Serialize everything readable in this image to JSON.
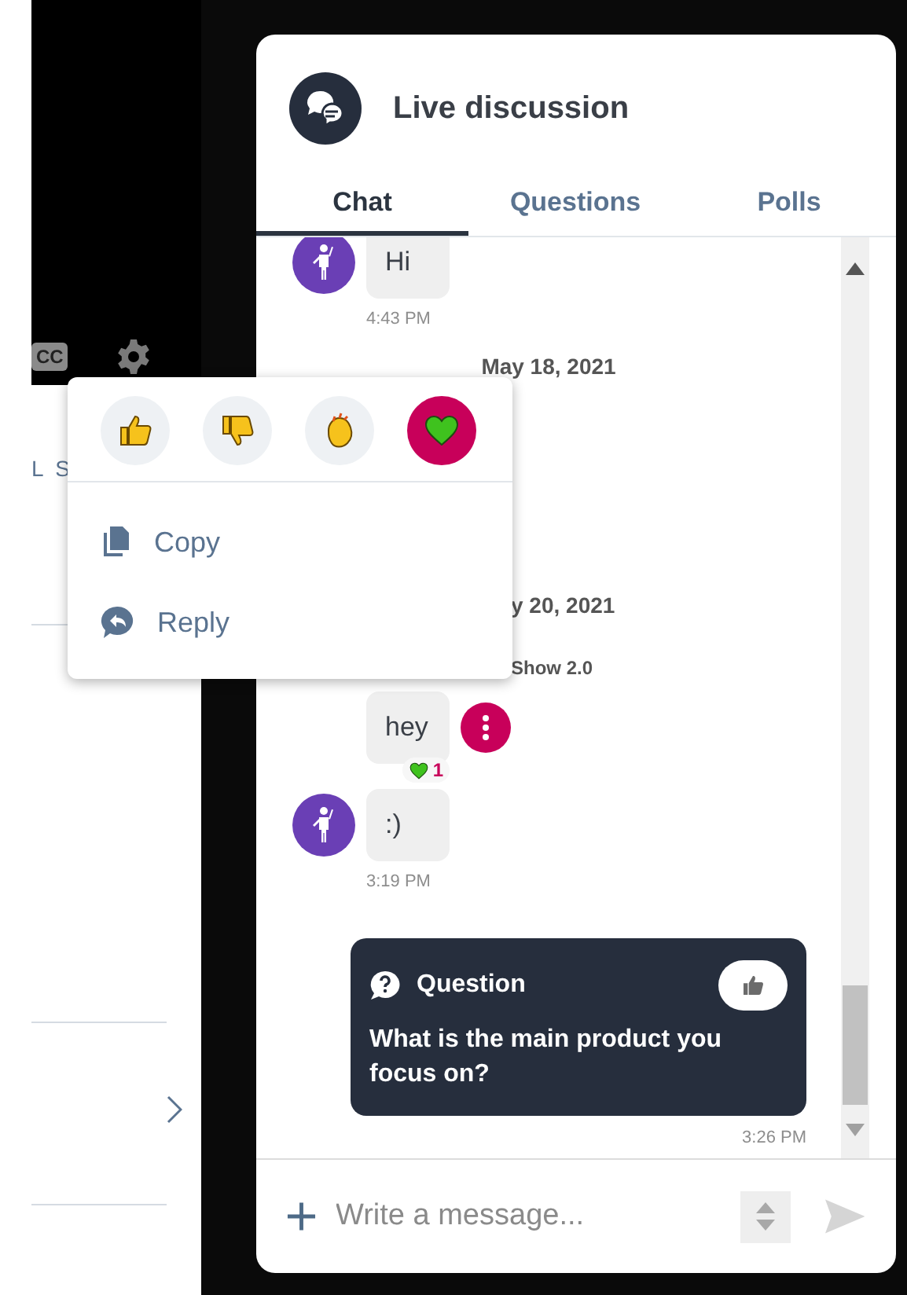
{
  "side_panel": {
    "cc_label": "CC",
    "link_text": "L S"
  },
  "chat_panel": {
    "title": "Live discussion",
    "tabs": [
      {
        "label": "Chat",
        "selected": true
      },
      {
        "label": "Questions",
        "selected": false
      },
      {
        "label": "Polls",
        "selected": false
      }
    ],
    "messages": [
      {
        "kind": "bubble",
        "avatar": true,
        "menu": false,
        "text": "Hi",
        "time": "4:43 PM"
      },
      {
        "kind": "date",
        "text": "May 18, 2021"
      },
      {
        "kind": "date_partial",
        "text": "y 20, 2021"
      },
      {
        "kind": "sender",
        "text": "Show 2.0"
      },
      {
        "kind": "bubble",
        "avatar": false,
        "text": "hey",
        "menu": true,
        "reaction": {
          "kind": "heart",
          "count": "1"
        }
      },
      {
        "kind": "bubble",
        "avatar": true,
        "menu": false,
        "text": ":)",
        "time": "3:19 PM"
      },
      {
        "kind": "question",
        "label": "Question",
        "text": "What is the main product you focus on?",
        "time": "3:26 PM"
      }
    ],
    "input": {
      "placeholder": "Write a message..."
    }
  },
  "context_menu": {
    "reactions": [
      {
        "kind": "thumbs_up",
        "selected": false
      },
      {
        "kind": "thumbs_down",
        "selected": false
      },
      {
        "kind": "clap",
        "selected": false
      },
      {
        "kind": "heart",
        "selected": true
      }
    ],
    "items": [
      {
        "kind": "copy",
        "label": "Copy"
      },
      {
        "kind": "reply",
        "label": "Reply"
      }
    ]
  }
}
